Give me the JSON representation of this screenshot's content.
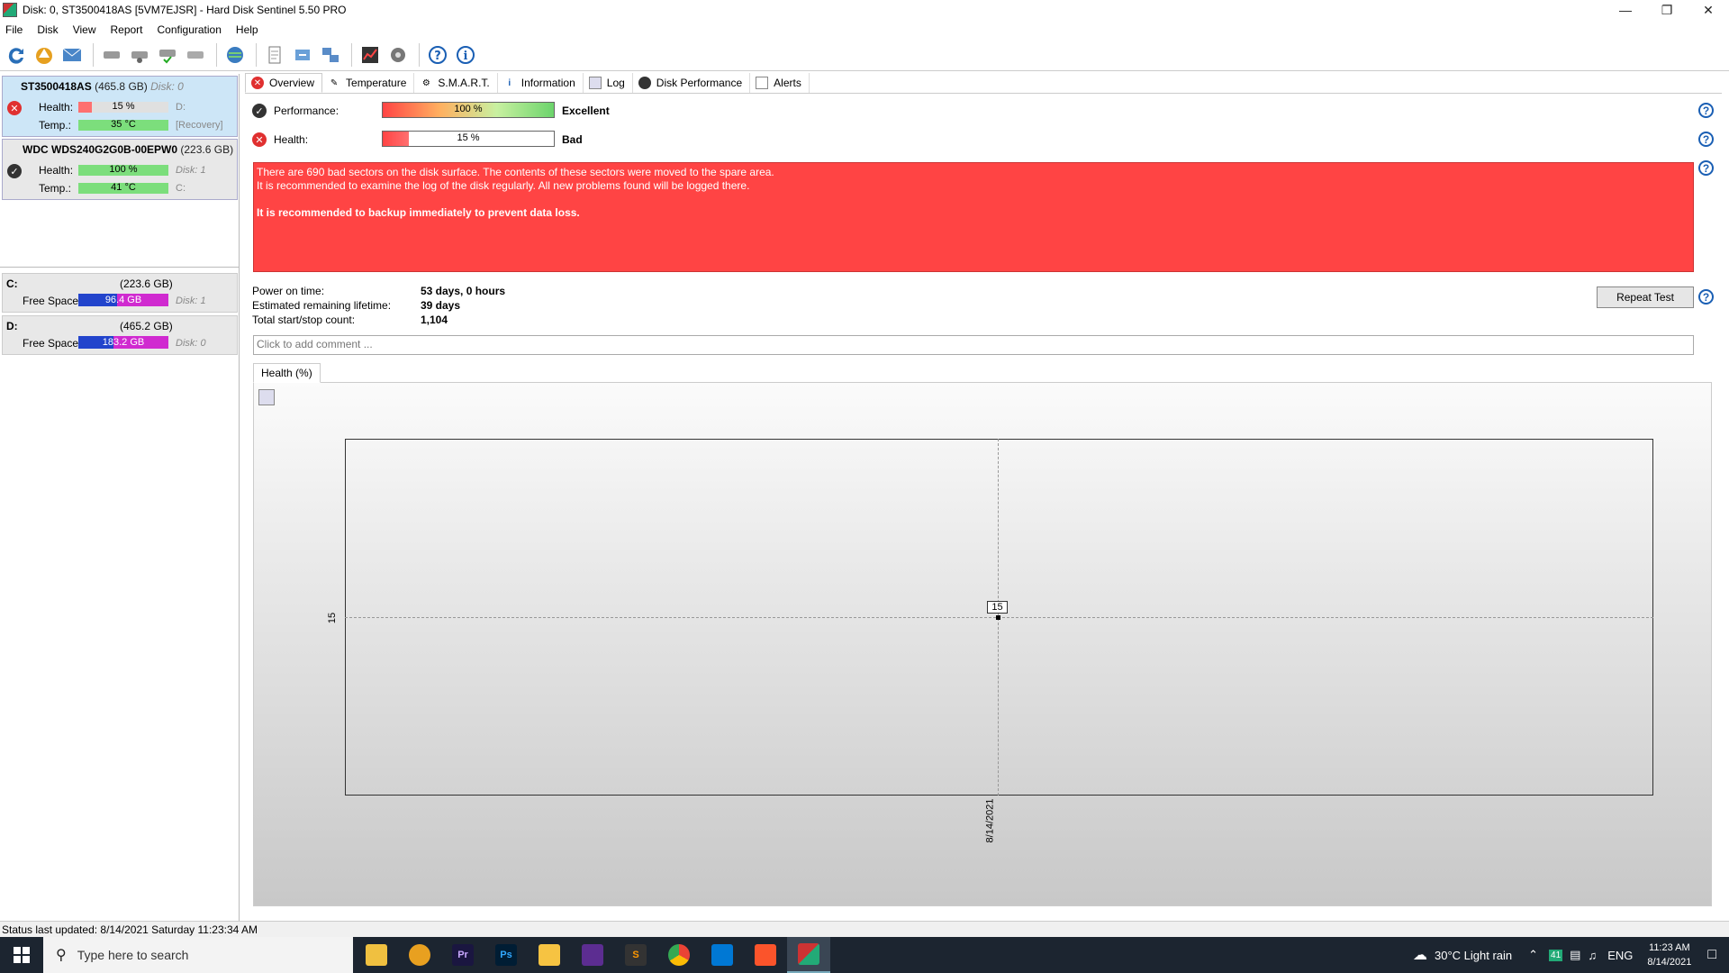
{
  "window": {
    "title": "Disk: 0, ST3500418AS [5VM7EJSR]  -  Hard Disk Sentinel 5.50 PRO"
  },
  "menu": [
    "File",
    "Disk",
    "View",
    "Report",
    "Configuration",
    "Help"
  ],
  "disks": [
    {
      "model": "ST3500418AS",
      "size": "(465.8 GB)",
      "disk": "Disk: 0",
      "health": "15 %",
      "health_pct": 15,
      "temp": "35 °C",
      "drive": "D:",
      "note": "[Recovery]",
      "status": "bad"
    },
    {
      "model": "WDC WDS240G2G0B-00EPW0",
      "size": "(223.6 GB)",
      "disk": "Disk: 1",
      "health": "100 %",
      "health_pct": 100,
      "temp": "41 °C",
      "drive": "C:",
      "status": "ok"
    }
  ],
  "labels": {
    "health": "Health:",
    "temp": "Temp.:",
    "free_space": "Free Space"
  },
  "drives": [
    {
      "letter": "C:",
      "size": "(223.6 GB)",
      "free": "96.4 GB",
      "free_pct": 43,
      "disk": "Disk: 1"
    },
    {
      "letter": "D:",
      "size": "(465.2 GB)",
      "free": "183.2 GB",
      "free_pct": 39,
      "disk": "Disk: 0"
    }
  ],
  "tabs": [
    "Overview",
    "Temperature",
    "S.M.A.R.T.",
    "Information",
    "Log",
    "Disk Performance",
    "Alerts"
  ],
  "overview": {
    "performance_label": "Performance:",
    "performance_value": "100 %",
    "performance_pct": 100,
    "performance_rating": "Excellent",
    "health_label": "Health:",
    "health_value": "15 %",
    "health_pct": 15,
    "health_rating": "Bad",
    "alert_lines": [
      "There are 690 bad sectors on the disk surface. The contents of these sectors were moved to the spare area.",
      "It is recommended to examine the log of the disk regularly. All new problems found will be logged there.",
      "It is recommended to backup immediately to prevent data loss."
    ],
    "power_on_label": "Power on time:",
    "power_on_value": "53 days, 0 hours",
    "remaining_label": "Estimated remaining lifetime:",
    "remaining_value": "39 days",
    "startstop_label": "Total start/stop count:",
    "startstop_value": "1,104",
    "repeat_button": "Repeat Test",
    "comment_placeholder": "Click to add comment ...",
    "chart_tab": "Health (%)"
  },
  "chart_data": {
    "type": "line",
    "x": [
      "8/14/2021"
    ],
    "series": [
      {
        "values": [
          15
        ]
      }
    ],
    "y_tick": "15",
    "x_tick": "8/14/2021",
    "point_label": "15"
  },
  "status": "Status last updated: 8/14/2021 Saturday 11:23:34 AM",
  "taskbar": {
    "search_placeholder": "Type here to search",
    "weather": "30°C  Light rain",
    "lang": "ENG",
    "time": "11:23 AM",
    "date": "8/14/2021",
    "badge": "41"
  },
  "colors": {
    "alert": "#ff4444",
    "good": "#6cd46c",
    "bad": "#ff5a5a",
    "free": "#2244cc",
    "used": "#d02ad0"
  }
}
